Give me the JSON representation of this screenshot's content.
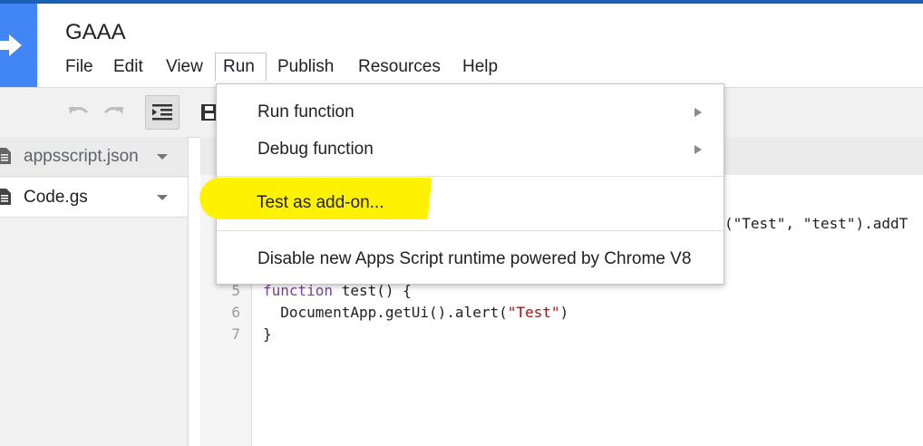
{
  "app": {
    "title": "GAAA",
    "accent_color": "#4285f4",
    "logo_icon": "arrow-right-icon"
  },
  "menubar": {
    "items": [
      "File",
      "Edit",
      "View",
      "Run",
      "Publish",
      "Resources",
      "Help"
    ],
    "active": "Run"
  },
  "toolbar": {
    "icons": [
      "undo-icon",
      "redo-icon",
      "indent-icon",
      "save-icon"
    ]
  },
  "files": [
    {
      "name": "appsscript.json",
      "icon": "document-icon"
    },
    {
      "name": "Code.gs",
      "icon": "document-icon"
    }
  ],
  "editor": {
    "partial_line_3": "(\"Test\", \"test\").addT",
    "line_numbers": [
      "5",
      "6",
      "7"
    ],
    "line5_keyword": "function",
    "line5_rest": " test() {",
    "line6_prefix": "  DocumentApp.getUi().alert(",
    "line6_string": "\"Test\"",
    "line6_suffix": ")",
    "line7": "}"
  },
  "run_menu": {
    "items": [
      {
        "label": "Run function",
        "submenu": true
      },
      {
        "label": "Debug function",
        "submenu": true
      },
      {
        "label": "Test as add-on...",
        "submenu": false,
        "highlighted": true
      },
      {
        "label": "Disable new Apps Script runtime powered by Chrome V8",
        "submenu": false
      }
    ],
    "highlight_color": "#fff200"
  }
}
